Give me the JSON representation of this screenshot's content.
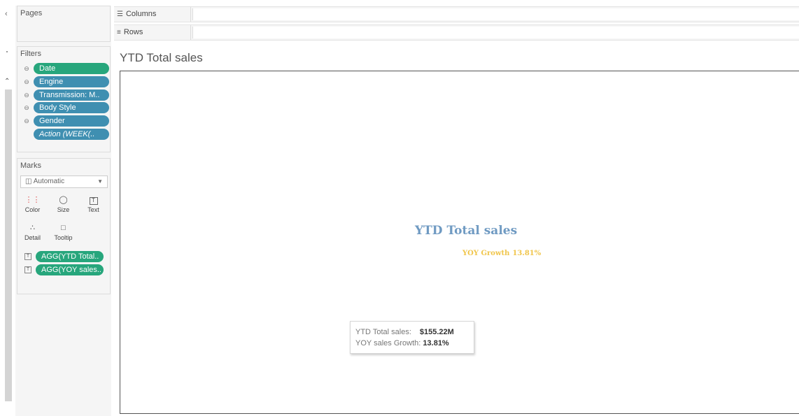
{
  "pages": {
    "title": "Pages"
  },
  "shelves": {
    "columns": {
      "icon": "columns-icon",
      "label": "Columns"
    },
    "rows": {
      "icon": "rows-icon",
      "label": "Rows"
    }
  },
  "filters": {
    "title": "Filters",
    "items": [
      {
        "label": "Date",
        "color": "#27a67c"
      },
      {
        "label": "Engine",
        "color": "#3f8fb1"
      },
      {
        "label": "Transmission: M..",
        "color": "#3f8fb1"
      },
      {
        "label": "Body Style",
        "color": "#3f8fb1"
      },
      {
        "label": "Gender",
        "color": "#3f8fb1"
      },
      {
        "label": "Action (WEEK(..",
        "color": "#3f8fb1"
      }
    ]
  },
  "marks": {
    "title": "Marks",
    "type": "Automatic",
    "buttons": {
      "color": "Color",
      "size": "Size",
      "text": "Text",
      "detail": "Detail",
      "tooltip": "Tooltip"
    },
    "fields": [
      {
        "label": "AGG(YTD Total..",
        "color": "#27a67c"
      },
      {
        "label": "AGG(YOY sales..",
        "color": "#27a67c"
      }
    ]
  },
  "view": {
    "title": "YTD Total sales",
    "kpi_title": "YTD Total sales",
    "kpi_growth_label": "YOY Growth",
    "kpi_growth_value": "13.81%",
    "kpi_title_color": "#6f9ac2",
    "kpi_growth_color": "#f0c54a"
  },
  "tooltip": {
    "row1_label": "YTD Total sales:",
    "row1_value": "$155.22M",
    "row2_label": "YOY sales Growth:",
    "row2_value": "13.81%"
  }
}
